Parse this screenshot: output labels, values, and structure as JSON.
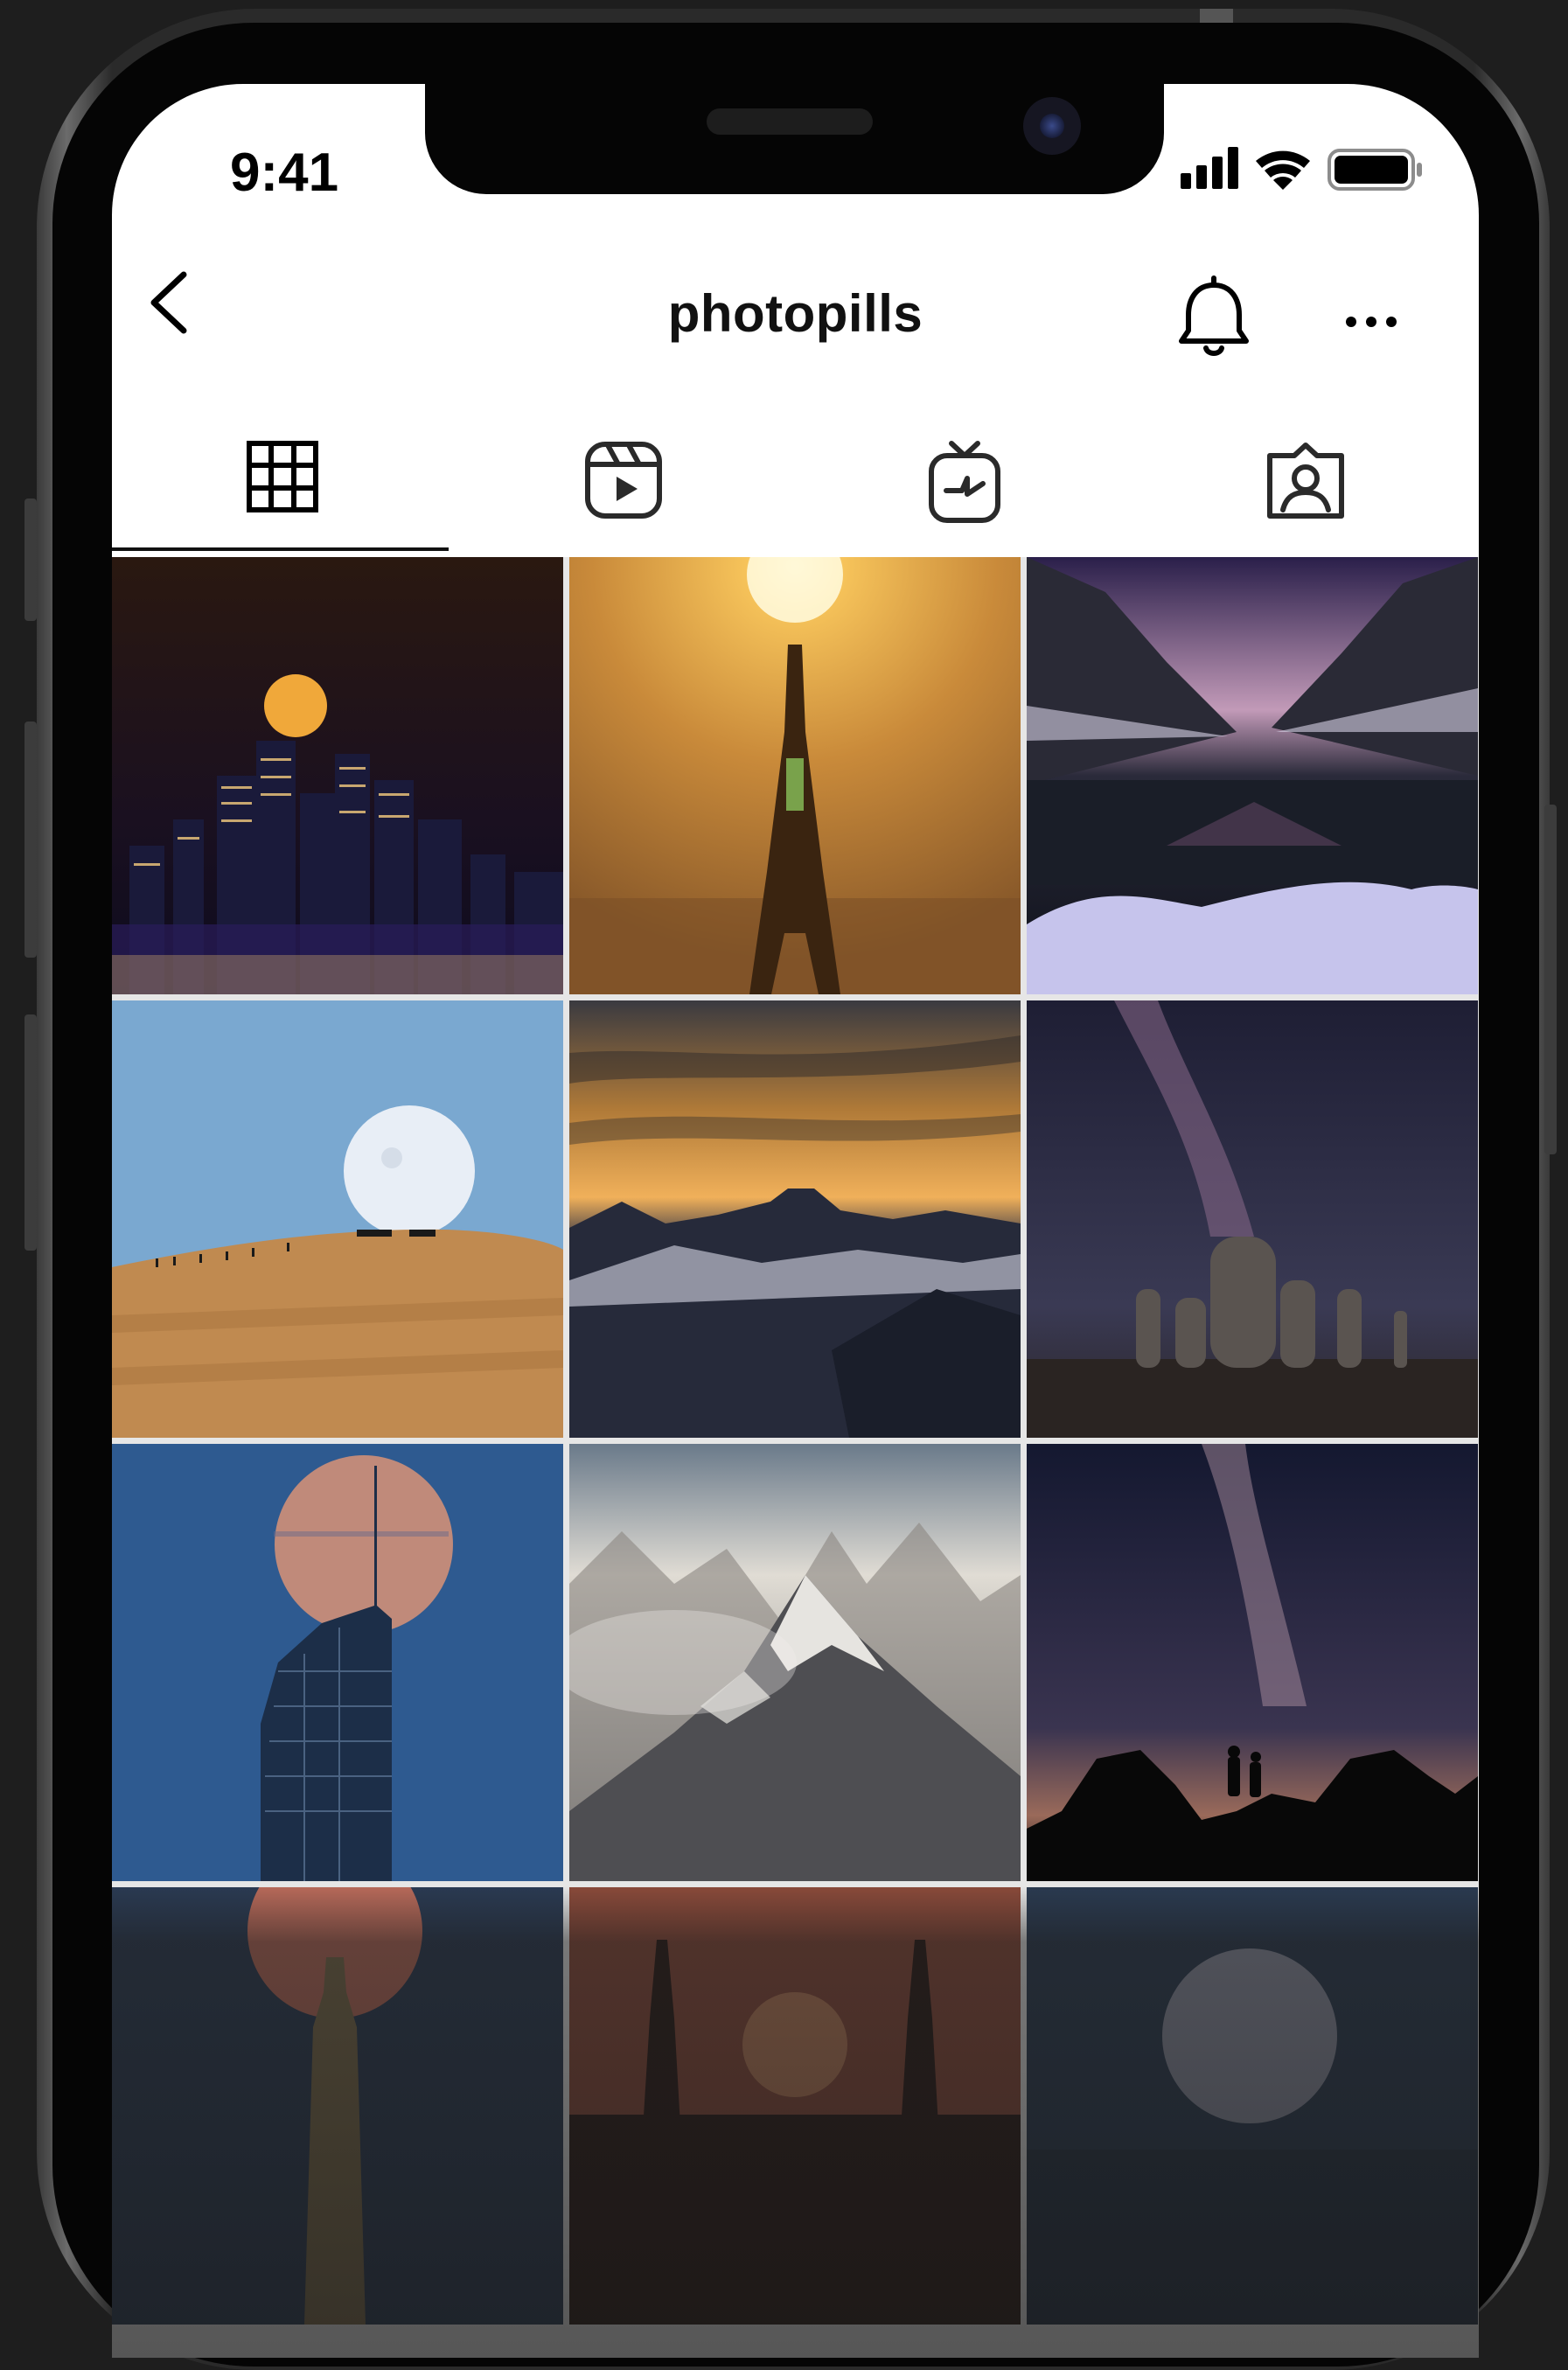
{
  "status_bar": {
    "time": "9:41",
    "icons": [
      "cellular-signal-icon",
      "wifi-icon",
      "battery-icon"
    ]
  },
  "header": {
    "title": "photopills",
    "back_icon": "chevron-left-icon",
    "notify_icon": "bell-icon",
    "more_icon": "more-horizontal-icon"
  },
  "tabs": [
    {
      "name": "posts",
      "icon": "grid-icon",
      "active": true
    },
    {
      "name": "reels",
      "icon": "reels-icon",
      "active": false
    },
    {
      "name": "igtv",
      "icon": "igtv-icon",
      "active": false
    },
    {
      "name": "tagged",
      "icon": "tagged-person-icon",
      "active": false
    }
  ],
  "posts": [
    {
      "scene": "city-skyline-with-moon"
    },
    {
      "scene": "eiffel-tower-sunrise"
    },
    {
      "scene": "mountain-lake-milky-way"
    },
    {
      "scene": "moonrise-over-cliff"
    },
    {
      "scene": "sunstar-over-peaks"
    },
    {
      "scene": "milky-way-over-statues"
    },
    {
      "scene": "moon-behind-skyscraper"
    },
    {
      "scene": "misty-mountain-peaks"
    },
    {
      "scene": "couple-under-milky-way"
    },
    {
      "scene": "moon-behind-tower"
    },
    {
      "scene": "sunset-behind-spires"
    },
    {
      "scene": "moon-over-night-horizon"
    }
  ],
  "colors": {
    "screen_bg": "#ffffff",
    "device_bg": "#1e1e1e",
    "text": "#111111",
    "active_tab_indicator": "#111111"
  }
}
